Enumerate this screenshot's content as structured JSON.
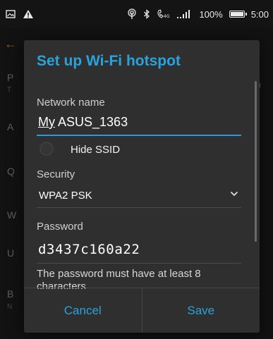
{
  "status_bar": {
    "battery_percent": "100%",
    "time": "5:00",
    "left_icons": [
      "image-icon",
      "warning-icon"
    ],
    "right_icons": [
      "hotspot-icon",
      "bluetooth-icon",
      "wifi-calling-icon",
      "signal-icon"
    ]
  },
  "background": {
    "letters": [
      "P",
      "T",
      "A",
      "Q",
      "W",
      "U",
      "B",
      "N"
    ]
  },
  "dialog": {
    "title": "Set up Wi-Fi hotspot",
    "network_name_label": "Network name",
    "network_name_prefix": "My",
    "network_name_rest": " ASUS_1363",
    "hide_ssid_label": "Hide SSID",
    "security_label": "Security",
    "security_value": "WPA2 PSK",
    "password_label": "Password",
    "password_value": "d3437c160a22",
    "password_hint": "The password must have at least 8 characters",
    "cancel_label": "Cancel",
    "save_label": "Save"
  },
  "colors": {
    "accent": "#29a3dd",
    "dialog_bg": "#2f2f2f",
    "screen_bg": "#121212"
  }
}
